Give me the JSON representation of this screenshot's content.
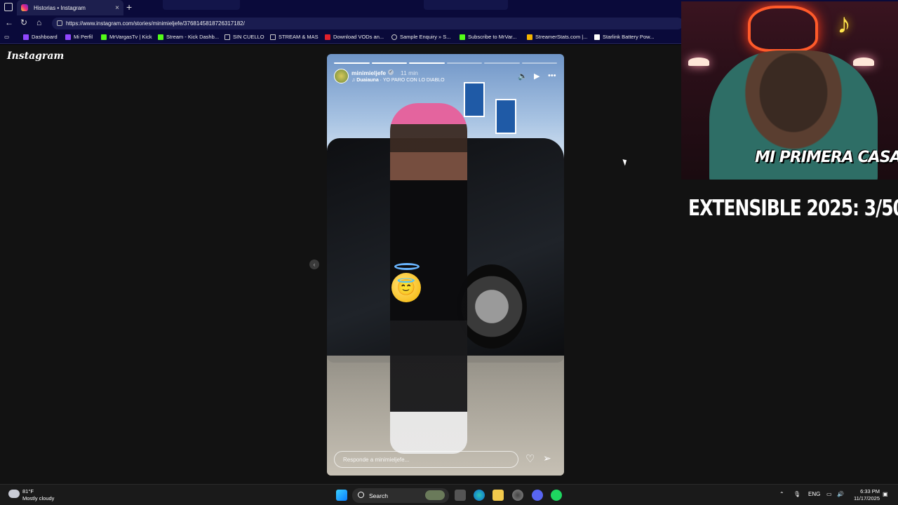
{
  "browser": {
    "tab_title": "Historias • Instagram",
    "tab_close": "×",
    "new_tab": "+",
    "url": "https://www.instagram.com/stories/minimieljefe/3768145818726317182/",
    "bookmarks": [
      {
        "label": "Dashboard",
        "color": "#9147ff"
      },
      {
        "label": "Mi Perfil",
        "color": "#9147ff"
      },
      {
        "label": "MrVargasTv | Kick",
        "color": "#53fc18"
      },
      {
        "label": "Stream - Kick Dashb...",
        "color": "#53fc18"
      },
      {
        "label": "SIN CUELLO",
        "color": "#cccccc"
      },
      {
        "label": "STREAM & MAS",
        "color": "#cccccc"
      },
      {
        "label": "Download VODs an...",
        "color": "#e0202b"
      },
      {
        "label": "Sample Enquiry » S...",
        "color": "#cccccc"
      },
      {
        "label": "Subscribe to MrVar...",
        "color": "#53fc18"
      },
      {
        "label": "StreamerStats.com |...",
        "color": "#f4b400"
      },
      {
        "label": "Starlink Battery Pow...",
        "color": "#ffffff"
      }
    ]
  },
  "instagram": {
    "logo": "Instagram",
    "story": {
      "username": "minimieljefe",
      "time_ago": "11 min",
      "music_artist": "Duaiauna",
      "music_separator": " · ",
      "music_title": "YO PARO CON LO DIABLO",
      "reply_placeholder": "Responde a minimieljefe...",
      "progress_segments": 6,
      "progress_done": 3
    }
  },
  "overlay": {
    "cam_logo": "MI PRIMERA CASA",
    "counter": "EXTENSIBLE 2025: 3/50"
  },
  "taskbar": {
    "temperature": "81°F",
    "condition": "Mostly cloudy",
    "search_label": "Search",
    "language": "ENG",
    "time": "6:33 PM",
    "date": "11/17/2025"
  }
}
